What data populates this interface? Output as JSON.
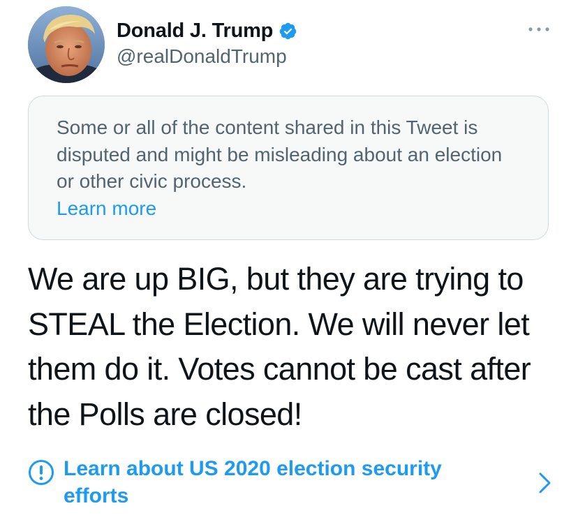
{
  "colors": {
    "accent": "#1d9bf0",
    "text_primary": "#0f1419",
    "text_secondary": "#536471",
    "notice_background": "#f7f9f9",
    "notice_border": "#cfd9de"
  },
  "author": {
    "display_name": "Donald J. Trump",
    "handle": "@realDonaldTrump",
    "verified": true,
    "verified_icon": "verified-badge-icon",
    "avatar_icon": "profile-avatar"
  },
  "more_menu": {
    "icon": "more-options-icon"
  },
  "notice": {
    "text": "Some or all of the content shared in this Tweet is disputed and might be misleading about an election or other civic process.",
    "link_label": "Learn more"
  },
  "tweet": {
    "text": "We are up BIG, but they are trying to STEAL the Election. We will never let them do it. Votes cannot be cast after the Polls are closed!"
  },
  "election_link": {
    "icon": "info-exclamation-icon",
    "label": "Learn about US 2020 election security efforts",
    "chevron_icon": "chevron-right-icon"
  }
}
